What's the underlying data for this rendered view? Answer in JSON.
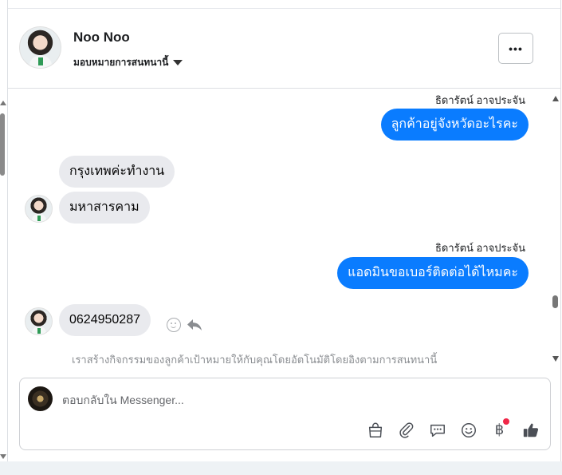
{
  "header": {
    "contact_name": "Noo Noo",
    "assign_label": "มอบหมายการสนทนานี้",
    "more_label": "•••"
  },
  "messages": [
    {
      "direction": "out",
      "sender": "ธิดารัตน์ อาจประจัน",
      "text": "ลูกค้าอยู่จังหวัดอะไรคะ"
    },
    {
      "direction": "in",
      "text": "กรุงเทพค่ะทำงาน"
    },
    {
      "direction": "in",
      "text": "มหาสารคาม"
    },
    {
      "direction": "out",
      "sender": "ธิดารัตน์ อาจประจัน",
      "text": "แอดมินขอเบอร์ติดต่อได้ไหมคะ"
    },
    {
      "direction": "in",
      "text": "0624950287"
    }
  ],
  "notice": "เราสร้างกิจกรรมของลูกค้าเป้าหมายให้กับคุณโดยอัตโนมัติโดยอิงตามการสนทนานี้",
  "composer": {
    "placeholder": "ตอบกลับใน Messenger...",
    "baht_symbol": "฿"
  },
  "colors": {
    "outgoing_bubble": "#0a7cff",
    "incoming_bubble": "#e9eaee",
    "notification_dot": "#f02849"
  },
  "icons": [
    "chevron-down-icon",
    "more-icon",
    "react-smiley-icon",
    "reply-icon",
    "shopping-bag-icon",
    "paperclip-icon",
    "saved-reply-icon",
    "emoji-icon",
    "baht-payment-icon",
    "thumbs-up-icon"
  ]
}
